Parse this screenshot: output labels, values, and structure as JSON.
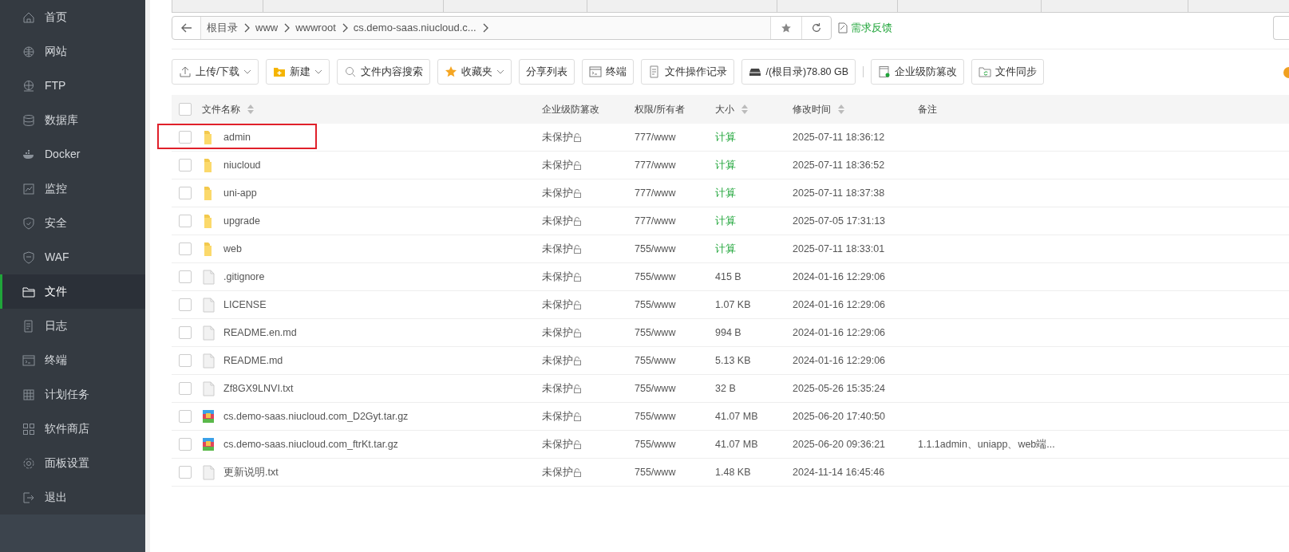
{
  "sidebar": {
    "items": [
      {
        "label": "首页",
        "selected": false
      },
      {
        "label": "网站",
        "selected": false
      },
      {
        "label": "FTP",
        "selected": false
      },
      {
        "label": "数据库",
        "selected": false
      },
      {
        "label": "Docker",
        "selected": false
      },
      {
        "label": "监控",
        "selected": false
      },
      {
        "label": "安全",
        "selected": false
      },
      {
        "label": "WAF",
        "selected": false
      },
      {
        "label": "文件",
        "selected": true
      },
      {
        "label": "日志",
        "selected": false
      },
      {
        "label": "终端",
        "selected": false
      },
      {
        "label": "计划任务",
        "selected": false
      },
      {
        "label": "软件商店",
        "selected": false
      },
      {
        "label": "面板设置",
        "selected": false
      },
      {
        "label": "退出",
        "selected": false
      }
    ]
  },
  "breadcrumb": [
    "根目录",
    "www",
    "wwwroot",
    "cs.demo-saas.niucloud.c..."
  ],
  "feedback": "需求反馈",
  "toolbar": [
    {
      "label": "上传/下载",
      "dropdown": true
    },
    {
      "label": "新建",
      "dropdown": true
    },
    {
      "label": "文件内容搜索",
      "dropdown": false
    },
    {
      "label": "收藏夹",
      "dropdown": true
    },
    {
      "label": "分享列表",
      "dropdown": false
    },
    {
      "label": "终端",
      "dropdown": false
    },
    {
      "label": "文件操作记录",
      "dropdown": false
    },
    {
      "label": "/(根目录)78.80 GB",
      "dropdown": false
    },
    {
      "label": "企业级防篡改",
      "dropdown": false
    },
    {
      "label": "文件同步",
      "dropdown": false
    }
  ],
  "table": {
    "select_all": {
      "checked": false
    },
    "columns": [
      {
        "label": "文件名称",
        "sortable": true
      },
      {
        "label": "企业级防篡改",
        "sortable": false
      },
      {
        "label": "权限/所有者",
        "sortable": false
      },
      {
        "label": "大小",
        "sortable": true
      },
      {
        "label": "修改时间",
        "sortable": true
      },
      {
        "label": "备注",
        "sortable": false
      }
    ],
    "rows": [
      {
        "kind": "folder",
        "checked": false,
        "name": "admin",
        "protect": "未保护",
        "perm": "777/www",
        "size": "计算",
        "mtime": "2025-07-11 18:36:12",
        "highlighted": true
      },
      {
        "kind": "folder",
        "checked": false,
        "name": "niucloud",
        "protect": "未保护",
        "perm": "777/www",
        "size": "计算",
        "mtime": "2025-07-11 18:36:52",
        "highlighted": false
      },
      {
        "kind": "folder",
        "checked": false,
        "name": "uni-app",
        "protect": "未保护",
        "perm": "777/www",
        "size": "计算",
        "mtime": "2025-07-11 18:37:38",
        "highlighted": false
      },
      {
        "kind": "folder",
        "checked": false,
        "name": "upgrade",
        "protect": "未保护",
        "perm": "777/www",
        "size": "计算",
        "mtime": "2025-07-05 17:31:13",
        "highlighted": false
      },
      {
        "kind": "folder",
        "checked": false,
        "name": "web",
        "protect": "未保护",
        "perm": "755/www",
        "size": "计算",
        "mtime": "2025-07-11 18:33:01",
        "highlighted": false
      },
      {
        "kind": "file",
        "checked": false,
        "name": ".gitignore",
        "protect": "未保护",
        "perm": "755/www",
        "size": "415 B",
        "mtime": "2024-01-16 12:29:06",
        "highlighted": false
      },
      {
        "kind": "file",
        "checked": false,
        "name": "LICENSE",
        "protect": "未保护",
        "perm": "755/www",
        "size": "1.07 KB",
        "mtime": "2024-01-16 12:29:06",
        "highlighted": false
      },
      {
        "kind": "file",
        "checked": false,
        "name": "README.en.md",
        "protect": "未保护",
        "perm": "755/www",
        "size": "994 B",
        "mtime": "2024-01-16 12:29:06",
        "highlighted": false
      },
      {
        "kind": "file",
        "checked": false,
        "name": "README.md",
        "protect": "未保护",
        "perm": "755/www",
        "size": "5.13 KB",
        "mtime": "2024-01-16 12:29:06",
        "highlighted": false
      },
      {
        "kind": "file",
        "checked": false,
        "name": "Zf8GX9LNVI.txt",
        "protect": "未保护",
        "perm": "755/www",
        "size": "32 B",
        "mtime": "2025-05-26 15:35:24",
        "highlighted": false
      },
      {
        "kind": "archive",
        "checked": false,
        "name": "cs.demo-saas.niucloud.com_D2Gyt.tar.gz",
        "protect": "未保护",
        "perm": "755/www",
        "size": "41.07 MB",
        "mtime": "2025-06-20 17:40:50",
        "highlighted": false
      },
      {
        "kind": "archive",
        "checked": false,
        "name": "cs.demo-saas.niucloud.com_ftrKt.tar.gz",
        "protect": "未保护",
        "perm": "755/www",
        "size": "41.07 MB",
        "mtime": "2025-06-20 09:36:21",
        "note": "1.1.1admin、uniapp、web端...",
        "highlighted": false
      },
      {
        "kind": "file",
        "checked": false,
        "name": "更新说明.txt",
        "protect": "未保护",
        "perm": "755/www",
        "size": "1.48 KB",
        "mtime": "2024-11-14 16:45:46",
        "highlighted": false
      }
    ]
  }
}
